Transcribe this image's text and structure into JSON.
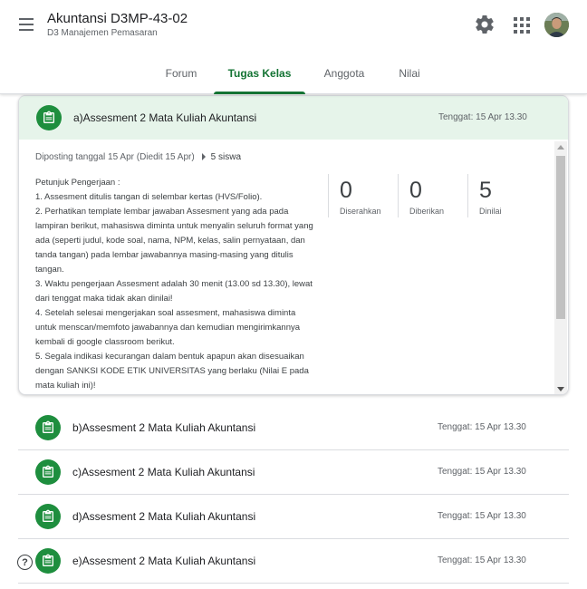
{
  "header": {
    "title": "Akuntansi D3MP-43-02",
    "subtitle": "D3 Manajemen Pemasaran",
    "icons": [
      "menu-icon",
      "gear-icon",
      "apps-grid-icon",
      "avatar"
    ]
  },
  "tabs": [
    {
      "label": "Forum",
      "active": false
    },
    {
      "label": "Tugas Kelas",
      "active": true
    },
    {
      "label": "Anggota",
      "active": false
    },
    {
      "label": "Nilai",
      "active": false
    }
  ],
  "colors": {
    "accent": "#137333",
    "icon_green": "#1e8e3e",
    "expanded_header_bg": "#e6f4ea"
  },
  "expanded": {
    "title": "a)Assesment 2 Mata Kuliah Akuntansi",
    "due": "Tenggat: 15 Apr 13.30",
    "posted": "Diposting tanggal 15 Apr (Diedit 15 Apr)",
    "students": "5 siswa",
    "instructions": "Petunjuk Pengerjaan :\n1. Assesment ditulis tangan di selembar kertas (HVS/Folio).\n2. Perhatikan template lembar jawaban Assesment yang ada pada lampiran berikut, mahasiswa diminta untuk menyalin seluruh format yang ada (seperti judul, kode soal, nama, NPM, kelas, salin pernyataan, dan tanda tangan) pada lembar jawabannya masing-masing yang ditulis tangan.\n3. Waktu pengerjaan Assesment adalah 30 menit (13.00 sd 13.30), lewat dari tenggat maka tidak akan dinilai!\n4. Setelah selesai mengerjakan soal assesment, mahasiswa diminta untuk menscan/memfoto jawabannya dan kemudian mengirimkannya kembali di google classroom berikut.\n5. Segala indikasi kecurangan dalam bentuk apapun akan disesuaikan dengan SANKSI KODE ETIK UNIVERSITAS yang berlaku (Nilai E pada mata kuliah ini)!",
    "stats": [
      {
        "value": "0",
        "label": "Diserahkan"
      },
      {
        "value": "0",
        "label": "Diberikan"
      },
      {
        "value": "5",
        "label": "Dinilai"
      }
    ]
  },
  "assignments": [
    {
      "title": "b)Assesment 2 Mata Kuliah Akuntansi",
      "due": "Tenggat: 15 Apr 13.30"
    },
    {
      "title": "c)Assesment 2 Mata Kuliah Akuntansi",
      "due": "Tenggat: 15 Apr 13.30"
    },
    {
      "title": "d)Assesment 2 Mata Kuliah Akuntansi",
      "due": "Tenggat: 15 Apr 13.30"
    },
    {
      "title": "e)Assesment 2 Mata Kuliah Akuntansi",
      "due": "Tenggat: 15 Apr 13.30"
    }
  ],
  "help": {
    "icon": "help-icon",
    "glyph": "?"
  }
}
